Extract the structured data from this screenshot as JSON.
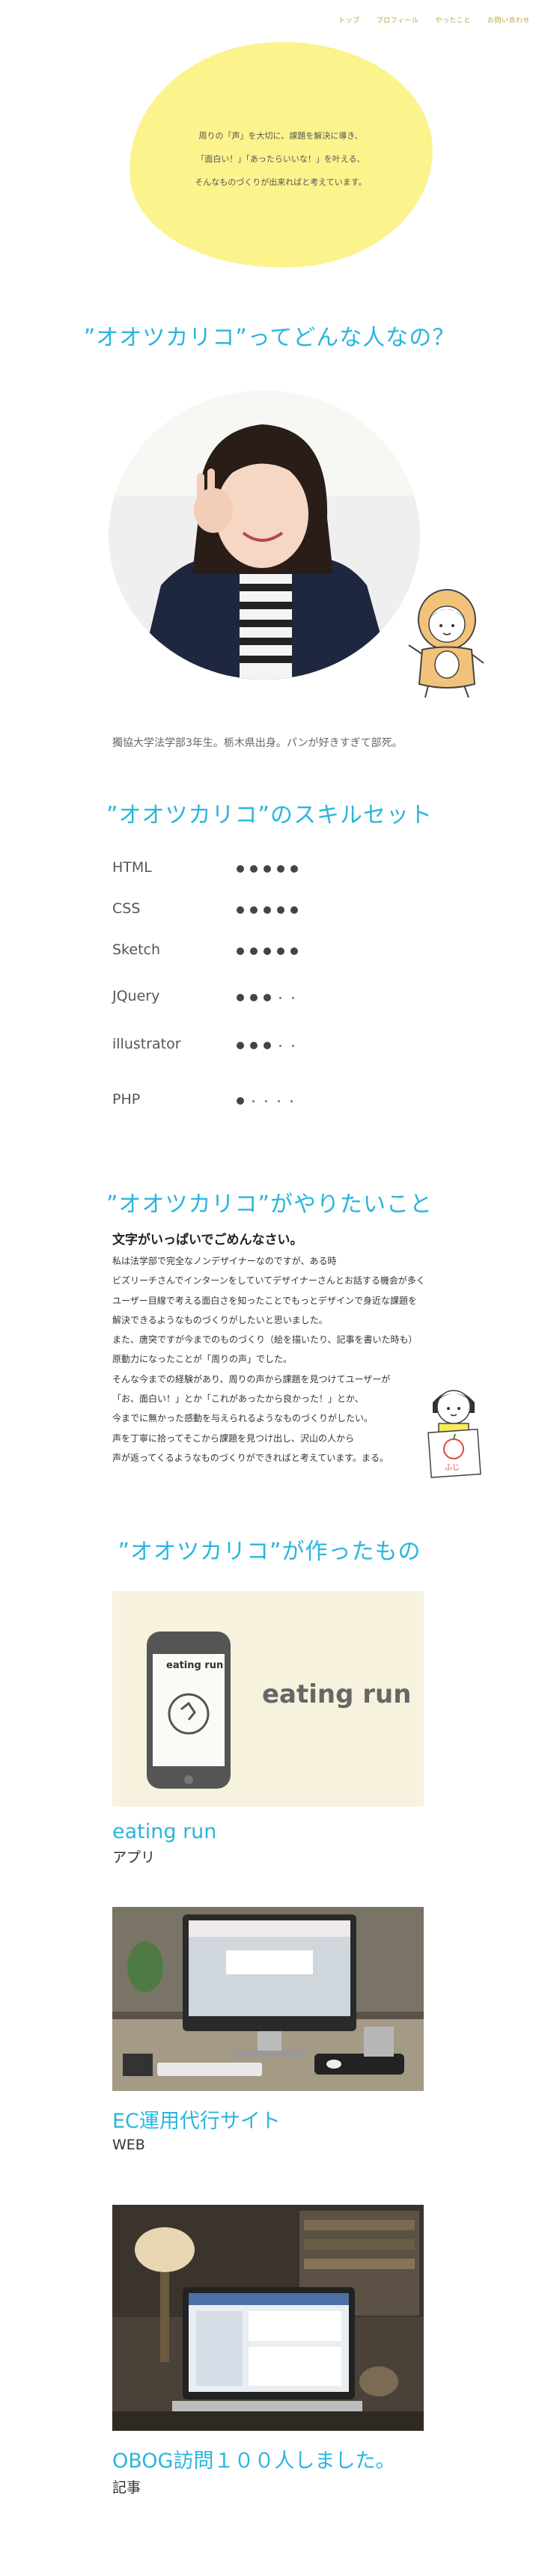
{
  "nav": {
    "items": [
      "トップ",
      "プロフィール",
      "やったこと",
      "お問い合わせ"
    ]
  },
  "intro": {
    "lines": [
      "周りの「声」を大切に、課題を解決に導き、",
      "「面白い！」「あったらいいな！」を叶える、",
      "そんなものづくりが出来ればと考えています。"
    ]
  },
  "about": {
    "heading": "”オオツカリコ”ってどんな人なの？",
    "caption": "獨協大学法学部3年生。栃木県出身。パンが好きすぎて部死。"
  },
  "skills": {
    "heading": "”オオツカリコ”のスキルセット",
    "items": [
      {
        "name": "HTML",
        "level": 5
      },
      {
        "name": "CSS",
        "level": 5
      },
      {
        "name": "Sketch",
        "level": 5
      },
      {
        "name": "JQuery",
        "level": 3
      },
      {
        "name": "illustrator",
        "level": 3
      },
      {
        "name": "PHP",
        "level": 1
      }
    ],
    "max_level": 5
  },
  "want": {
    "heading": "”オオツカリコ”がやりたいこと",
    "lead": "文字がいっぱいでごめんなさい。",
    "lines": [
      "私は法学部で完全なノンデザイナーなのですが、ある時",
      "ビズリーチさんでインターンをしていてデザイナーさんとお話する機会が多く",
      "ユーザー目線で考える面白さを知ったことでもっとデザインで身近な課題を",
      "解決できるようなものづくりがしたいと思いました。",
      "また、唐突ですが今までのものづくり（絵を描いたり、記事を書いた時も）",
      "原動力になったことが「周りの声」でした。",
      "そんな今までの経験があり、周りの声から課題を見つけてユーザーが",
      "「お、面白い！」とか「これがあったから良かった！」とか、",
      "今までに無かった感動を与えられるようなものづくりがしたい。",
      "声を丁寧に拾ってそこから課題を見つけ出し、沢山の人から",
      "声が返ってくるようなものづくりができればと考えています。まる。"
    ],
    "mascot_sign": "ふじ"
  },
  "works": {
    "heading": "”オオツカリコ”が作ったもの",
    "items": [
      {
        "title": "eating run",
        "category": "アプリ",
        "phone_label": "eating run",
        "banner_label": "eating run"
      },
      {
        "title": "EC運用代行サイト",
        "category": "WEB"
      },
      {
        "title": "OBOG訪問１００人しました。",
        "category": "記事"
      }
    ]
  },
  "colors": {
    "accent": "#29b6dd",
    "blob": "#fbf38c",
    "nav": "#b9a646"
  }
}
